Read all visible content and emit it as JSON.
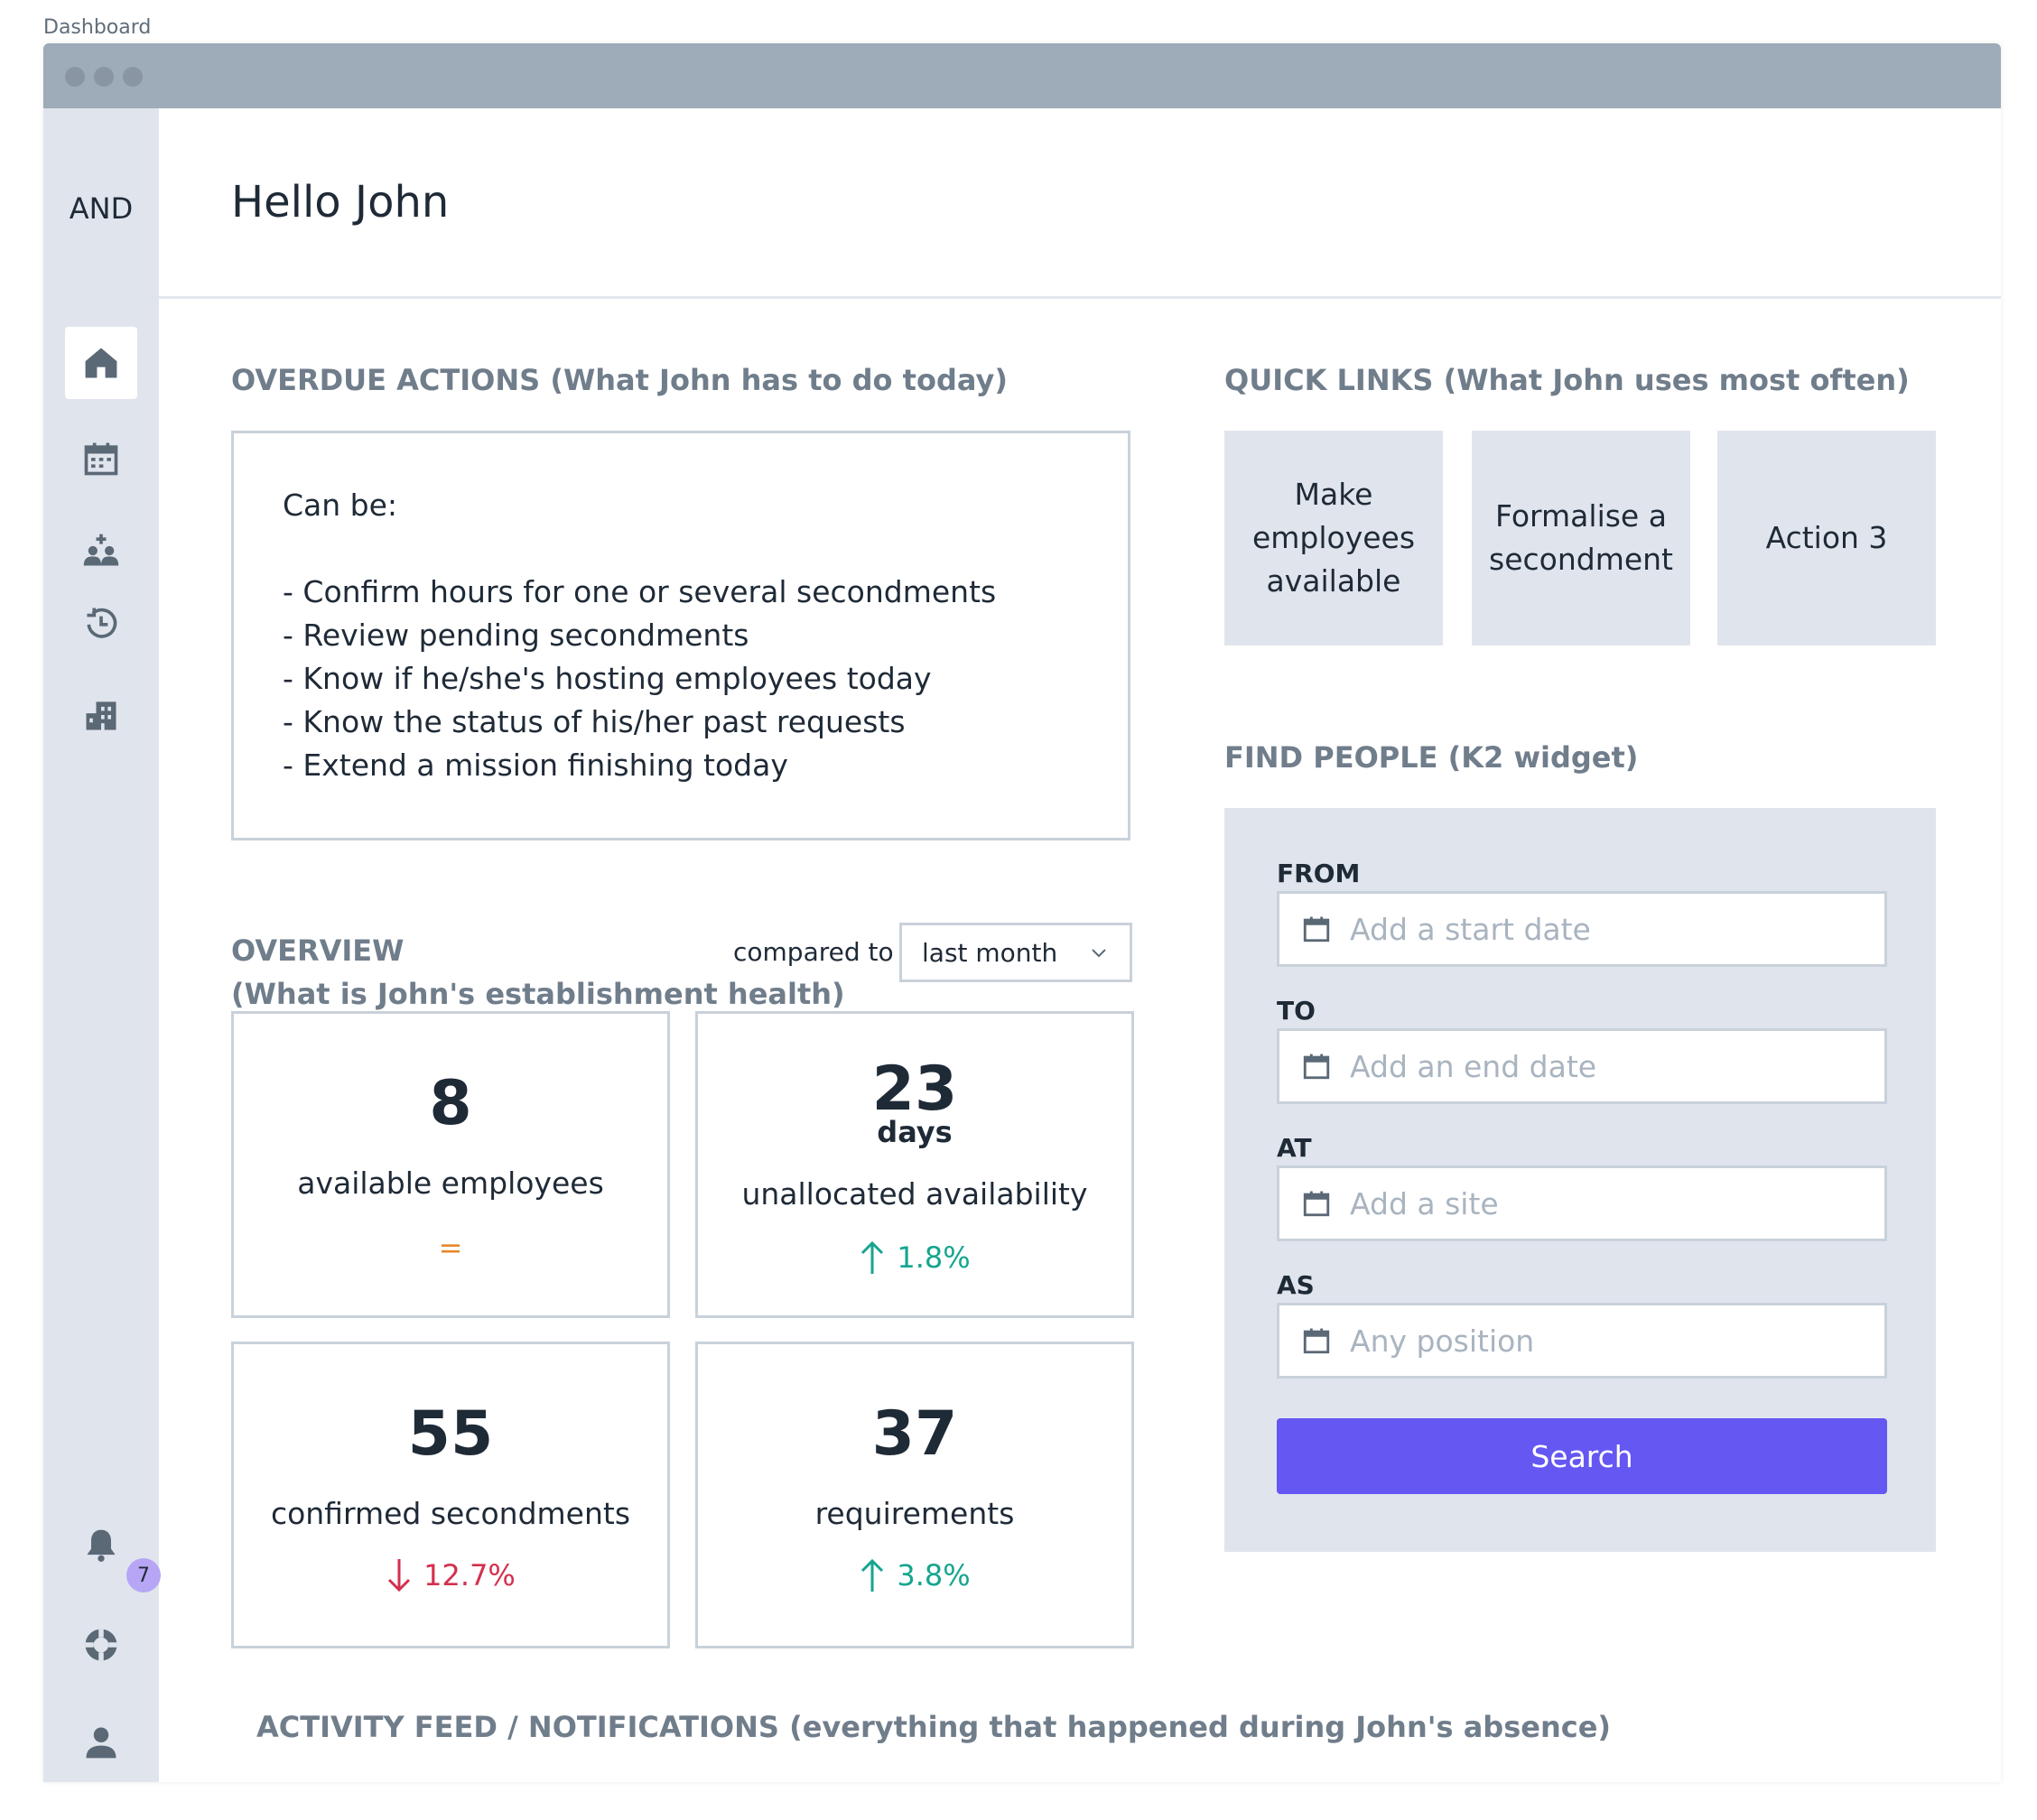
{
  "frame_label": "Dashboard",
  "sidebar": {
    "logo": "AND",
    "items": [
      {
        "icon": "home-icon",
        "active": true
      },
      {
        "icon": "calendar-icon",
        "active": false
      },
      {
        "icon": "people-add-icon",
        "active": false
      },
      {
        "icon": "history-icon",
        "active": false
      },
      {
        "icon": "building-icon",
        "active": false
      }
    ],
    "bottom": {
      "notifications_icon": "bell-icon",
      "notifications_count": "7",
      "help_icon": "lifebuoy-icon",
      "profile_icon": "user-icon"
    }
  },
  "header": {
    "title": "Hello John"
  },
  "overdue": {
    "title": "OVERDUE ACTIONS (What John has to do today)",
    "intro": "Can be:",
    "items": [
      "- Confirm hours for one or several secondments",
      "- Review pending secondments",
      "- Know if he/she's hosting employees today",
      "- Know the status of his/her past requests",
      "- Extend a mission finishing today"
    ]
  },
  "overview": {
    "title": "OVERVIEW",
    "subtitle": "(What is John's establishment health)",
    "compared_label": "compared to",
    "compared_value": "last month",
    "stats": [
      {
        "value": "8",
        "unit": "",
        "label": "available employees",
        "trend": "=",
        "direction": "flat"
      },
      {
        "value": "23",
        "unit": "days",
        "label": "unallocated availability",
        "trend": "1.8%",
        "direction": "up"
      },
      {
        "value": "55",
        "unit": "",
        "label": "confirmed secondments",
        "trend": "12.7%",
        "direction": "down"
      },
      {
        "value": "37",
        "unit": "",
        "label": "requirements",
        "trend": "3.8%",
        "direction": "up"
      }
    ]
  },
  "quick_links": {
    "title": "QUICK LINKS (What John uses most often)",
    "items": [
      {
        "label": "Make employees available"
      },
      {
        "label": "Formalise a secondment"
      },
      {
        "label": "Action 3"
      }
    ]
  },
  "find_people": {
    "title": "FIND PEOPLE (K2 widget)",
    "fields": [
      {
        "label": "FROM",
        "placeholder": "Add a start date",
        "value": ""
      },
      {
        "label": "TO",
        "placeholder": "Add an end date",
        "value": ""
      },
      {
        "label": "AT",
        "placeholder": "Add a site",
        "value": ""
      },
      {
        "label": "AS",
        "placeholder": "Any position",
        "value": ""
      }
    ],
    "search_label": "Search"
  },
  "activity": {
    "title": "ACTIVITY FEED / NOTIFICATIONS (everything that happened during John's absence)"
  },
  "colors": {
    "sidebar_bg": "#e0e5ed",
    "accent": "#6557f2",
    "trend_up": "#15a58f",
    "trend_down": "#d3304e",
    "trend_flat": "#e6882a",
    "badge": "#b7a6f5"
  }
}
